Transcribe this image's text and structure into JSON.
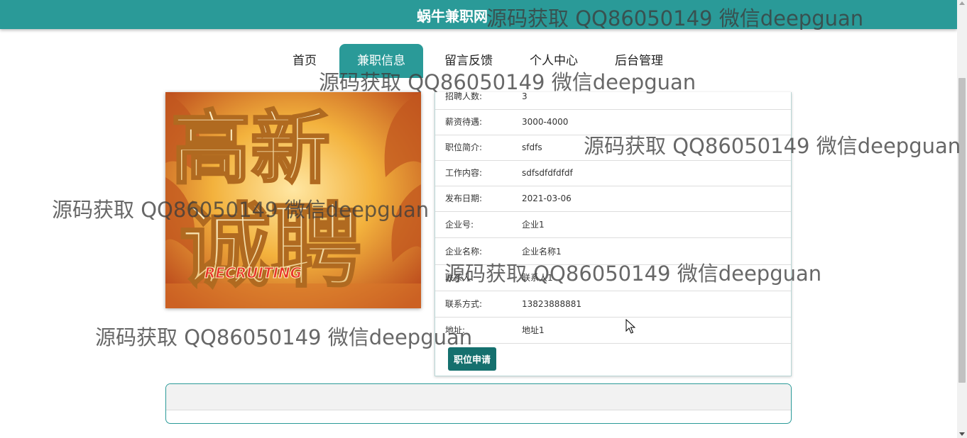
{
  "header": {
    "site_title": "蜗牛兼职网"
  },
  "nav": {
    "items": [
      {
        "label": "首页"
      },
      {
        "label": "兼职信息",
        "active": true
      },
      {
        "label": "留言反馈"
      },
      {
        "label": "个人中心"
      },
      {
        "label": "后台管理"
      }
    ]
  },
  "poster": {
    "alt": "高薪诚聘 RECRUITING",
    "text_line1": "高新",
    "text_line2": "诚聘",
    "banner": "RECRUITING"
  },
  "detail": {
    "rows": [
      {
        "label": "招聘人数:",
        "value": "3"
      },
      {
        "label": "薪资待遇:",
        "value": "3000-4000"
      },
      {
        "label": "职位简介:",
        "value": "sfdfs"
      },
      {
        "label": "工作内容:",
        "value": "sdfsdfdfdfdf"
      },
      {
        "label": "发布日期:",
        "value": "2021-03-06"
      },
      {
        "label": "企业号:",
        "value": "企业1"
      },
      {
        "label": "企业名称:",
        "value": "企业名称1"
      },
      {
        "label": "联系人:",
        "value": "联系人1"
      },
      {
        "label": "联系方式:",
        "value": "13823888881"
      },
      {
        "label": "地址:",
        "value": "地址1"
      }
    ],
    "apply_button": "职位申请"
  },
  "watermark": "源码获取 QQ86050149 微信deepguan",
  "colors": {
    "primary": "#2a9a98",
    "button": "#15706e"
  }
}
